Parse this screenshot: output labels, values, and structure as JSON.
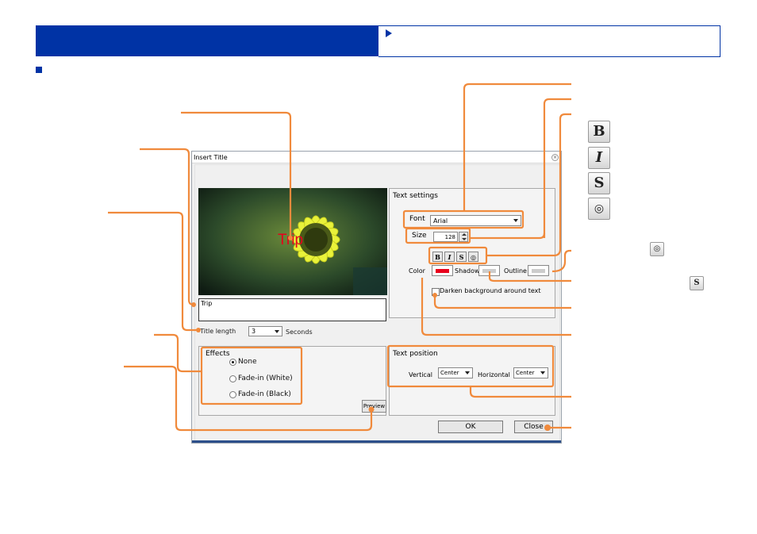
{
  "dialog": {
    "title": "Insert Title",
    "title_input_value": "Trip",
    "preview_overlay_text": "Trip",
    "title_length_label": "Title length",
    "title_length_value": "3",
    "title_length_unit": "Seconds",
    "effects": {
      "label": "Effects",
      "options": [
        "None",
        "Fade-in (White)",
        "Fade-in (Black)"
      ],
      "selected": "None",
      "preview_button": "Preview"
    },
    "text_settings": {
      "label": "Text settings",
      "font_label": "Font",
      "font_value": "Arial",
      "size_label": "Size",
      "size_value": "128",
      "style_buttons": [
        "B",
        "I",
        "S",
        "◎"
      ],
      "color_label": "Color",
      "shadow_label": "Shadow",
      "outline_label": "Outline",
      "darken_label": "Darken background around text",
      "colors": {
        "text": "#e8001c",
        "shadow": "#cccccc",
        "outline": "#cccccc"
      }
    },
    "text_position": {
      "label": "Text position",
      "vertical_label": "Vertical",
      "vertical_value": "Center",
      "horizontal_label": "Horizontal",
      "horizontal_value": "Center"
    },
    "ok_button": "OK",
    "close_button": "Close"
  },
  "legend": {
    "bold_icon": "B",
    "italic_icon": "I",
    "shadow_icon": "S",
    "outline_icon": "◎"
  },
  "colors": {
    "header_blue": "#0033a5",
    "callout_orange": "#f08a3c"
  }
}
